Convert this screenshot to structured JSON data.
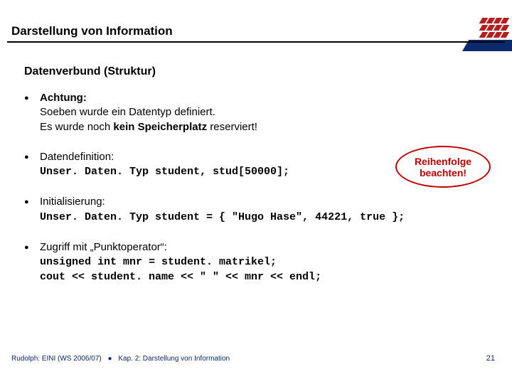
{
  "title": "Darstellung von Information",
  "subtitle": "Datenverbund (Struktur)",
  "bullets": {
    "b1": {
      "lead": "Achtung:",
      "l1": "Soeben wurde ein Datentyp definiert.",
      "l2a": "Es wurde noch ",
      "l2b": "kein Speicherplatz",
      "l2c": " reserviert!"
    },
    "b2": {
      "lead": "Datendefinition:",
      "code": "Unser. Daten. Typ student, stud[50000];"
    },
    "b3": {
      "lead": "Initialisierung:",
      "code": "Unser. Daten. Typ student = { \"Hugo Hase\", 44221, true };"
    },
    "b4": {
      "lead": "Zugriff mit „Punktoperator“:",
      "code1": "unsigned int mnr = student. matrikel;",
      "code2": "cout << student. name << \" \" << mnr << endl;"
    }
  },
  "callout": "Reihenfolge beachten!",
  "footer": {
    "left": "Rudolph: EINI (WS 2006/07)",
    "right": "Kap. 2: Darstellung von Information"
  },
  "page": "21"
}
